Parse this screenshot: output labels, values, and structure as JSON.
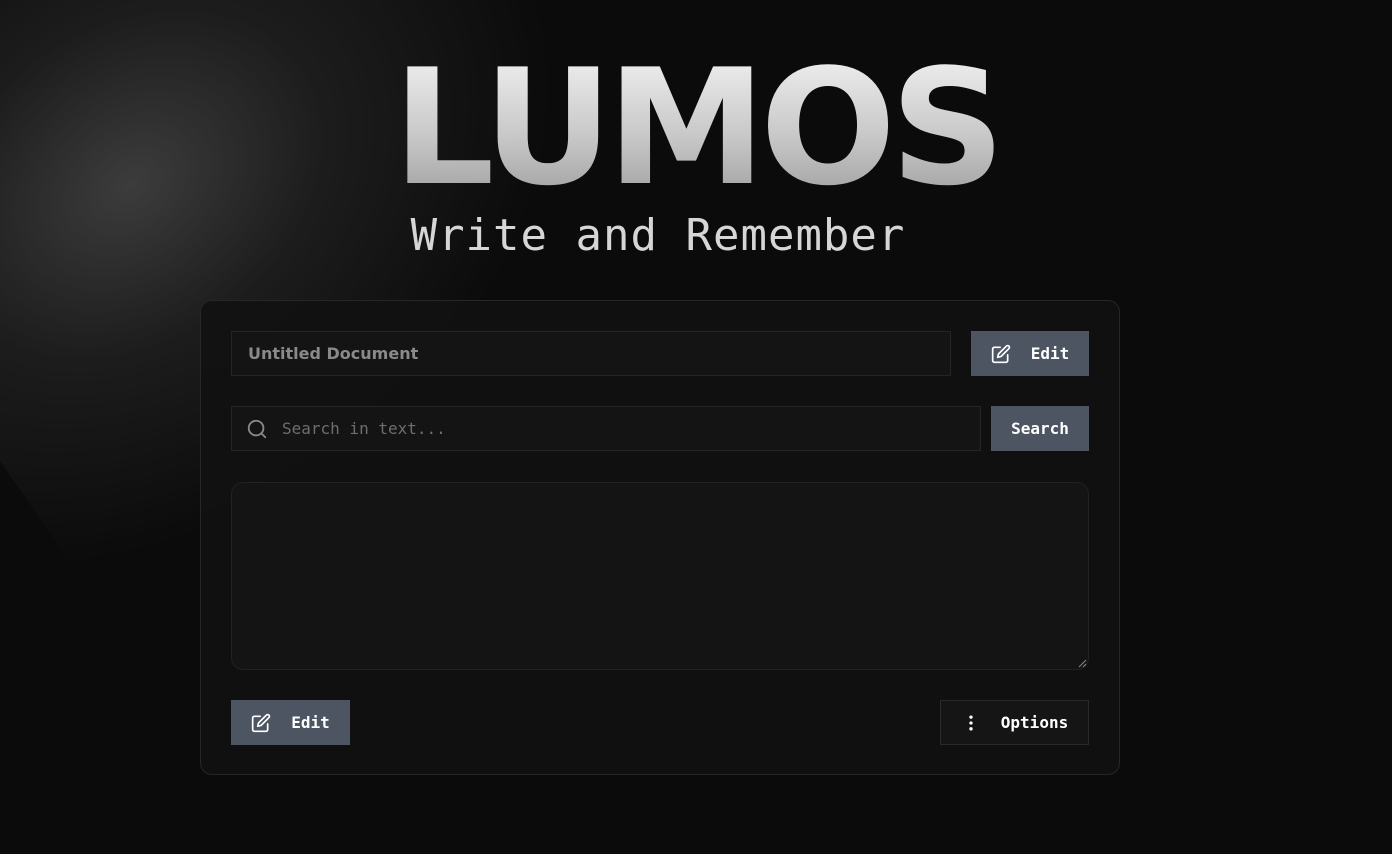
{
  "app": {
    "title": "LUMOS",
    "subtitle": "Write and Remember"
  },
  "document": {
    "title_value": "Untitled Document",
    "edit_title_label": "Edit",
    "body_value": ""
  },
  "search": {
    "placeholder": "Search in text...",
    "button_label": "Search",
    "icon": "search-icon"
  },
  "actions": {
    "edit_label": "Edit",
    "edit_icon": "pencil-square-icon",
    "options_label": "Options",
    "options_icon": "vertical-dots-icon"
  },
  "colors": {
    "background": "#0b0b0b",
    "card": "#111111",
    "button": "#4d5563"
  }
}
